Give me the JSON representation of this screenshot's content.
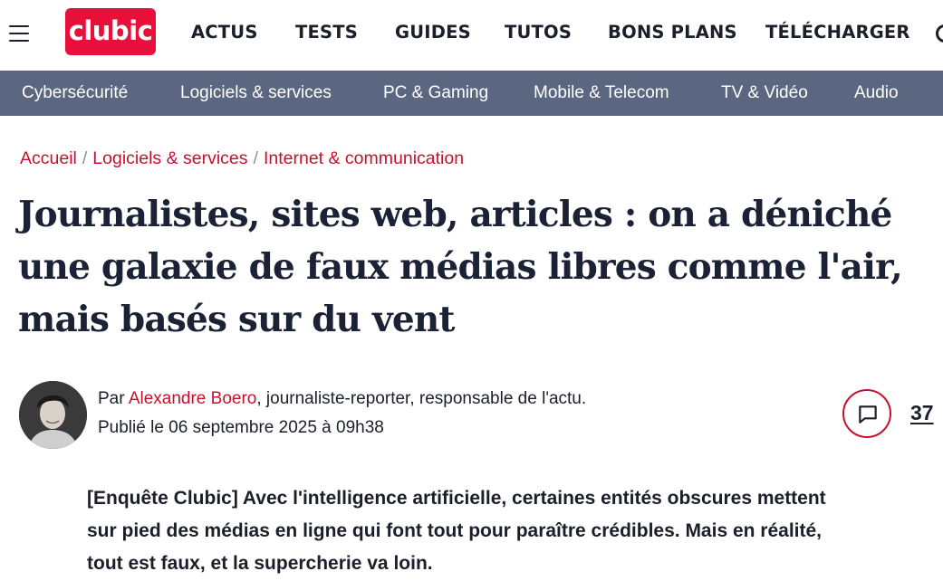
{
  "header": {
    "logo_text": "clubic",
    "nav": [
      "ACTUS",
      "TESTS",
      "GUIDES",
      "TUTOS",
      "BONS PLANS",
      "TÉLÉCHARGER"
    ],
    "menu_icon": "hamburger-menu-icon",
    "search_icon": "search-icon"
  },
  "subnav": [
    "Cybersécurité",
    "Logiciels & services",
    "PC & Gaming",
    "Mobile & Telecom",
    "TV & Vidéo",
    "Audio"
  ],
  "breadcrumb": {
    "items": [
      "Accueil",
      "Logiciels & services",
      "Internet & communication"
    ],
    "separator": "/"
  },
  "article": {
    "title": "Journalistes, sites web, articles : on a déniché une galaxie de faux médias libres comme l'air, mais basés sur du vent",
    "author": {
      "prefix": "Par",
      "name": "Alexandre Boero",
      "role": ", journaliste-reporter, responsable de l'actu."
    },
    "published": "Publié le 06 septembre 2025 à 09h38",
    "comment_count": "37",
    "intro": "[Enquête Clubic] Avec l'intelligence artificielle, certaines entités obscures mettent sur pied des médias en ligne qui font tout pour paraître crédibles. Mais en réalité, tout est faux, et la supercherie va loin."
  },
  "colors": {
    "brand_red": "#e8103a",
    "link_red": "#c8102e",
    "subnav_bg": "#5b6781",
    "title_text": "#1b2236"
  }
}
